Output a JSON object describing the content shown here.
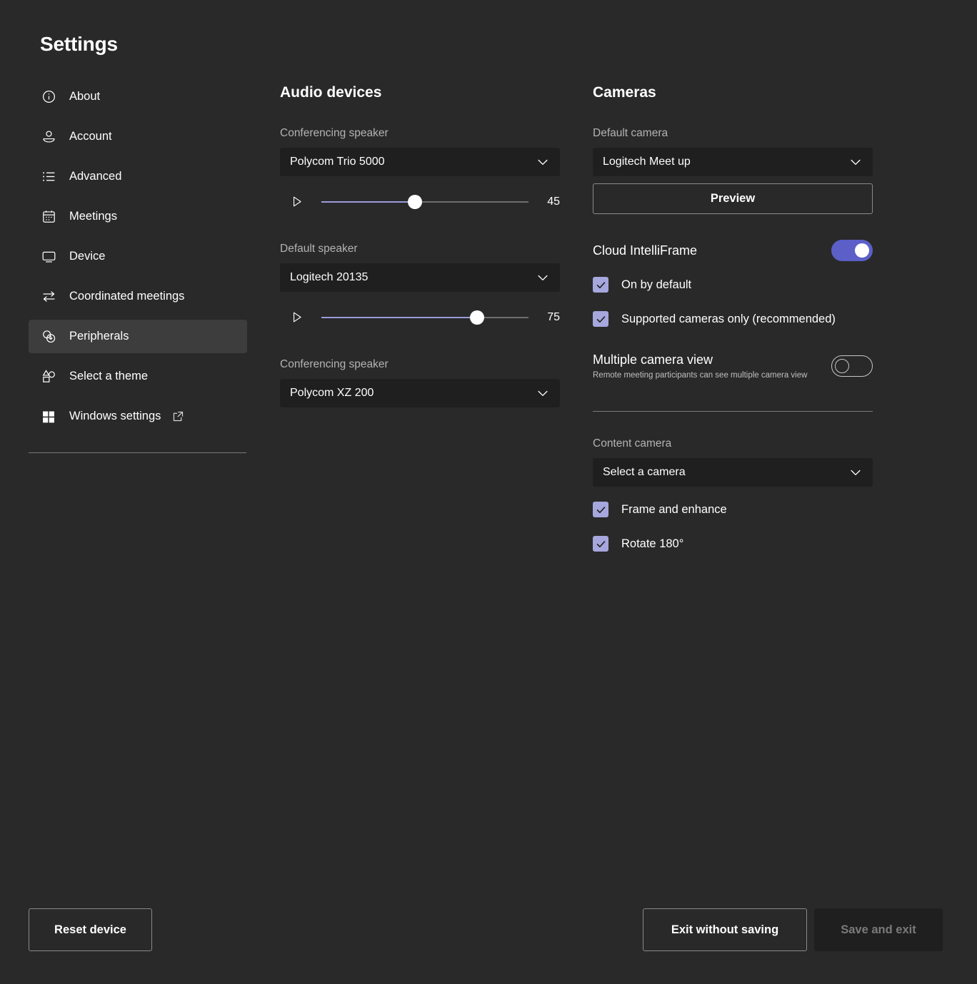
{
  "page": {
    "title": "Settings"
  },
  "sidebar": {
    "items": [
      {
        "label": "About",
        "icon": "info-circle-icon",
        "selected": false,
        "external": false
      },
      {
        "label": "Account",
        "icon": "account-person-icon",
        "selected": false,
        "external": false
      },
      {
        "label": "Advanced",
        "icon": "list-icon",
        "selected": false,
        "external": false
      },
      {
        "label": "Meetings",
        "icon": "calendar-icon",
        "selected": false,
        "external": false
      },
      {
        "label": "Device",
        "icon": "monitor-icon",
        "selected": false,
        "external": false
      },
      {
        "label": "Coordinated meetings",
        "icon": "arrows-swap-icon",
        "selected": false,
        "external": false
      },
      {
        "label": "Peripherals",
        "icon": "peripherals-circles-icon",
        "selected": true,
        "external": false
      },
      {
        "label": "Select a theme",
        "icon": "shapes-theme-icon",
        "selected": false,
        "external": false
      },
      {
        "label": "Windows settings",
        "icon": "windows-logo-icon",
        "selected": false,
        "external": true
      }
    ]
  },
  "audio": {
    "heading": "Audio devices",
    "conferencing_speaker_label": "Conferencing speaker",
    "conferencing_speaker_value": "Polycom Trio 5000",
    "conferencing_speaker_volume": 45,
    "default_speaker_label": "Default speaker",
    "default_speaker_value": "Logitech 20135",
    "default_speaker_volume": 75,
    "conferencing_speaker2_label": "Conferencing speaker",
    "conferencing_speaker2_value": "Polycom XZ 200"
  },
  "cameras": {
    "heading": "Cameras",
    "default_camera_label": "Default camera",
    "default_camera_value": "Logitech Meet up",
    "preview_label": "Preview",
    "intelliframe_label": "Cloud IntelliFrame",
    "intelliframe_on": true,
    "on_by_default_label": "On by default",
    "on_by_default_checked": true,
    "supported_cameras_label": "Supported cameras only (recommended)",
    "supported_cameras_checked": true,
    "multiple_camera_view_label": "Multiple camera view",
    "multiple_camera_view_sub": "Remote meeting participants can see multiple camera view",
    "multiple_camera_view_on": false,
    "content_camera_label": "Content camera",
    "content_camera_value": "Select a camera",
    "frame_enhance_label": "Frame and enhance",
    "frame_enhance_checked": true,
    "rotate_label": "Rotate 180°",
    "rotate_checked": true
  },
  "footer": {
    "reset_label": "Reset device",
    "exit_label": "Exit without saving",
    "save_label": "Save and exit",
    "save_enabled": false
  },
  "colors": {
    "background": "#292929",
    "field_background": "#1f1f1f",
    "accent_toggle": "#5b5fc7",
    "accent_checkbox": "#a6a7dc",
    "slider_fill": "#9a9cdb",
    "selected_nav": "#3d3d3d"
  }
}
